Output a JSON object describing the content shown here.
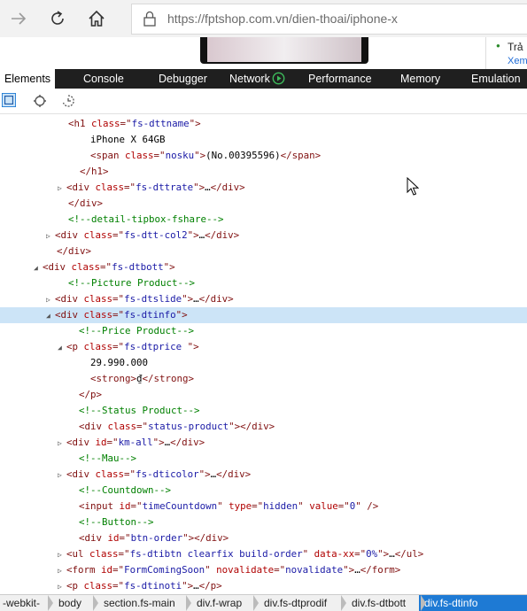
{
  "browser": {
    "url": "https://fptshop.com.vn/dien-thoai/iphone-x"
  },
  "page_side": {
    "bullet": "●",
    "line1": "Trả",
    "line2": "Xem"
  },
  "devtools": {
    "tabs": [
      "Elements",
      "Console",
      "Debugger",
      "Network",
      "Performance",
      "Memory",
      "Emulation"
    ],
    "active_tab": "Elements"
  },
  "dom": [
    {
      "p": "<",
      "t": "h1",
      "a": [
        [
          "class",
          "fs-dttname"
        ]
      ],
      "e": ">"
    },
    {
      "x": "iPhone X 64GB"
    },
    {
      "p": "<",
      "t": "span",
      "a": [
        [
          "class",
          "nosku"
        ]
      ],
      "e": ">",
      "x": "(No.00395596)",
      "close": "span"
    },
    {
      "close_only": "h1"
    },
    {
      "arrow": "right",
      "p": "<",
      "t": "div",
      "a": [
        [
          "class",
          "fs-dttrate"
        ]
      ],
      "e": ">",
      "x": "…",
      "close": "div"
    },
    {
      "close_only": "div"
    },
    {
      "c": "<!--detail-tipbox-fshare-->"
    },
    {
      "arrow": "right",
      "p": "<",
      "t": "div",
      "a": [
        [
          "class",
          "fs-dtt-col2"
        ]
      ],
      "e": ">",
      "x": "…",
      "close": "div"
    },
    {
      "close_only": "div"
    },
    {
      "arrow": "down",
      "p": "<",
      "t": "div",
      "a": [
        [
          "class",
          "fs-dtbott"
        ]
      ],
      "e": ">"
    },
    {
      "c": "<!--Picture Product-->"
    },
    {
      "arrow": "right",
      "p": "<",
      "t": "div",
      "a": [
        [
          "class",
          "fs-dtslide"
        ]
      ],
      "e": ">",
      "x": "…",
      "close": "div"
    },
    {
      "arrow": "down",
      "p": "<",
      "t": "div",
      "a": [
        [
          "class",
          "fs-dtinfo"
        ]
      ],
      "e": ">",
      "sel": true
    },
    {
      "c": "<!--Price Product-->"
    },
    {
      "arrow": "down",
      "p": "<",
      "t": "p",
      "a": [
        [
          "class",
          "fs-dtprice "
        ]
      ],
      "e": ">"
    },
    {
      "x": "29.990.000"
    },
    {
      "p": "<",
      "t": "strong",
      "a": [],
      "e": ">",
      "x": "₫",
      "close": "strong"
    },
    {
      "close_only": "p"
    },
    {
      "c": "<!--Status Product-->"
    },
    {
      "p": "<",
      "t": "div",
      "a": [
        [
          "class",
          "status-product"
        ]
      ],
      "e": ">",
      "x": "",
      "close": "div"
    },
    {
      "arrow": "right",
      "p": "<",
      "t": "div",
      "a": [
        [
          "id",
          "km-all"
        ]
      ],
      "e": ">",
      "x": "…",
      "close": "div"
    },
    {
      "c": "<!--Mau-->"
    },
    {
      "arrow": "right",
      "p": "<",
      "t": "div",
      "a": [
        [
          "class",
          "fs-dticolor"
        ]
      ],
      "e": ">",
      "x": "…",
      "close": "div"
    },
    {
      "c": "<!--Countdown-->"
    },
    {
      "p": "<",
      "t": "input",
      "a": [
        [
          "id",
          "timeCountdown"
        ],
        [
          "type",
          "hidden"
        ],
        [
          "value",
          "0"
        ]
      ],
      "e": " />"
    },
    {
      "c": "<!--Button-->"
    },
    {
      "p": "<",
      "t": "div",
      "a": [
        [
          "id",
          "btn-order"
        ]
      ],
      "e": ">",
      "x": "",
      "close": "div"
    },
    {
      "arrow": "right",
      "p": "<",
      "t": "ul",
      "a": [
        [
          "class",
          "fs-dtibtn clearfix build-order"
        ],
        [
          "data-xx",
          "0%"
        ]
      ],
      "e": ">",
      "x": "…",
      "close": "ul"
    },
    {
      "arrow": "right",
      "p": "<",
      "t": "form",
      "a": [
        [
          "id",
          "FormComingSoon"
        ],
        [
          "novalidate",
          "novalidate"
        ]
      ],
      "e": ">",
      "x": "…",
      "close": "form"
    },
    {
      "arrow": "right",
      "p": "<",
      "t": "p",
      "a": [
        [
          "class",
          "fs-dtinoti"
        ]
      ],
      "e": ">",
      "x": "…",
      "close": "p"
    }
  ],
  "breadcrumb": [
    "-webkit-",
    "body",
    "section.fs-main",
    "div.f-wrap",
    "div.fs-dtprodif",
    "div.fs-dtbott",
    "div.fs-dtinfo"
  ]
}
